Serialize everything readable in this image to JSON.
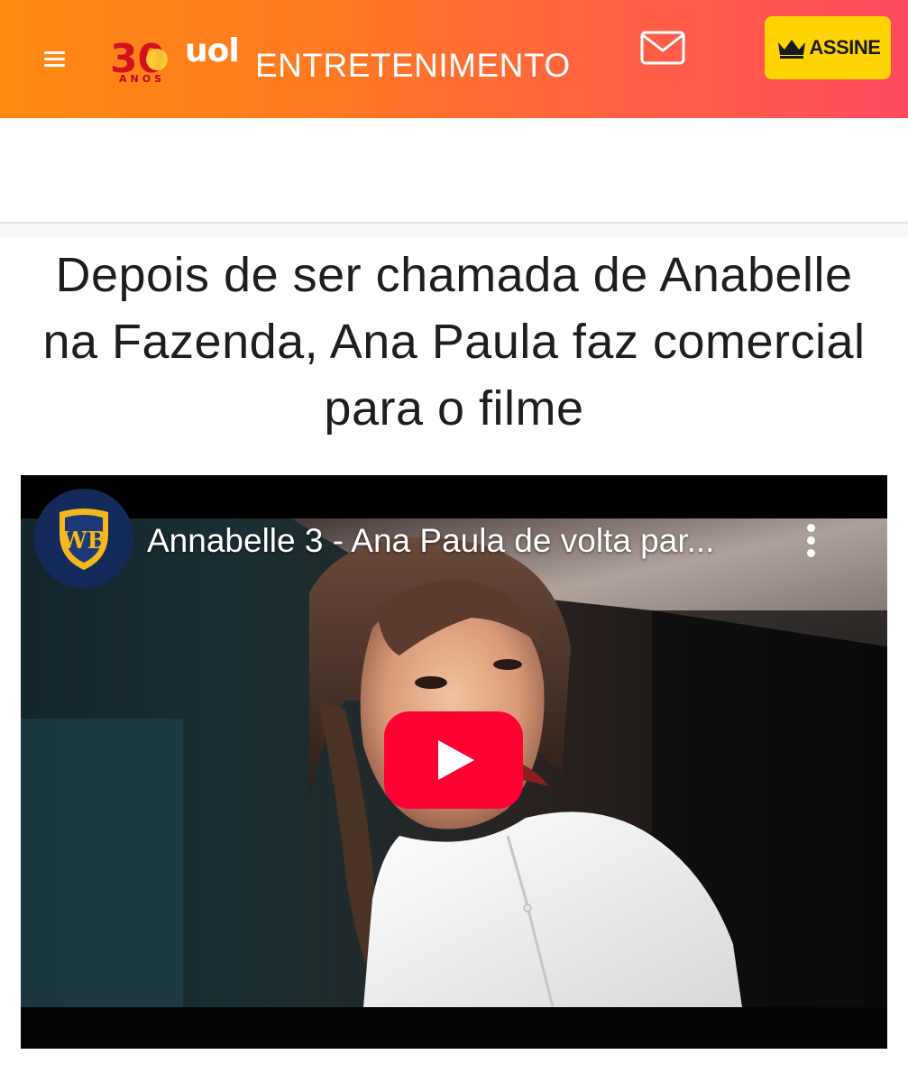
{
  "header": {
    "logo_badge": "30",
    "logo_anos": "ANOS",
    "logo_brand": "uol",
    "section": "ENTRETENIMENTO",
    "subscribe_label": "ASSINE",
    "colors": {
      "gradient_start": "#ff8a12",
      "gradient_end": "#ff4a5e",
      "subscribe_bg": "#ffd400"
    },
    "icons": {
      "menu": "hamburger-menu-icon",
      "mail": "envelope-icon",
      "subscribe": "crown-icon"
    }
  },
  "article": {
    "headline": "Depois de ser chamada de Anabelle na Fazenda, Ana Paula faz comercial para o filme"
  },
  "video": {
    "channel_logo_text": "WB",
    "title": "Annabelle 3 - Ana Paula de volta par...",
    "icons": {
      "more": "more-vertical-icon",
      "play": "youtube-play-icon"
    },
    "colors": {
      "play_button": "#ff0033",
      "channel_shield": "#f5b81c"
    }
  }
}
